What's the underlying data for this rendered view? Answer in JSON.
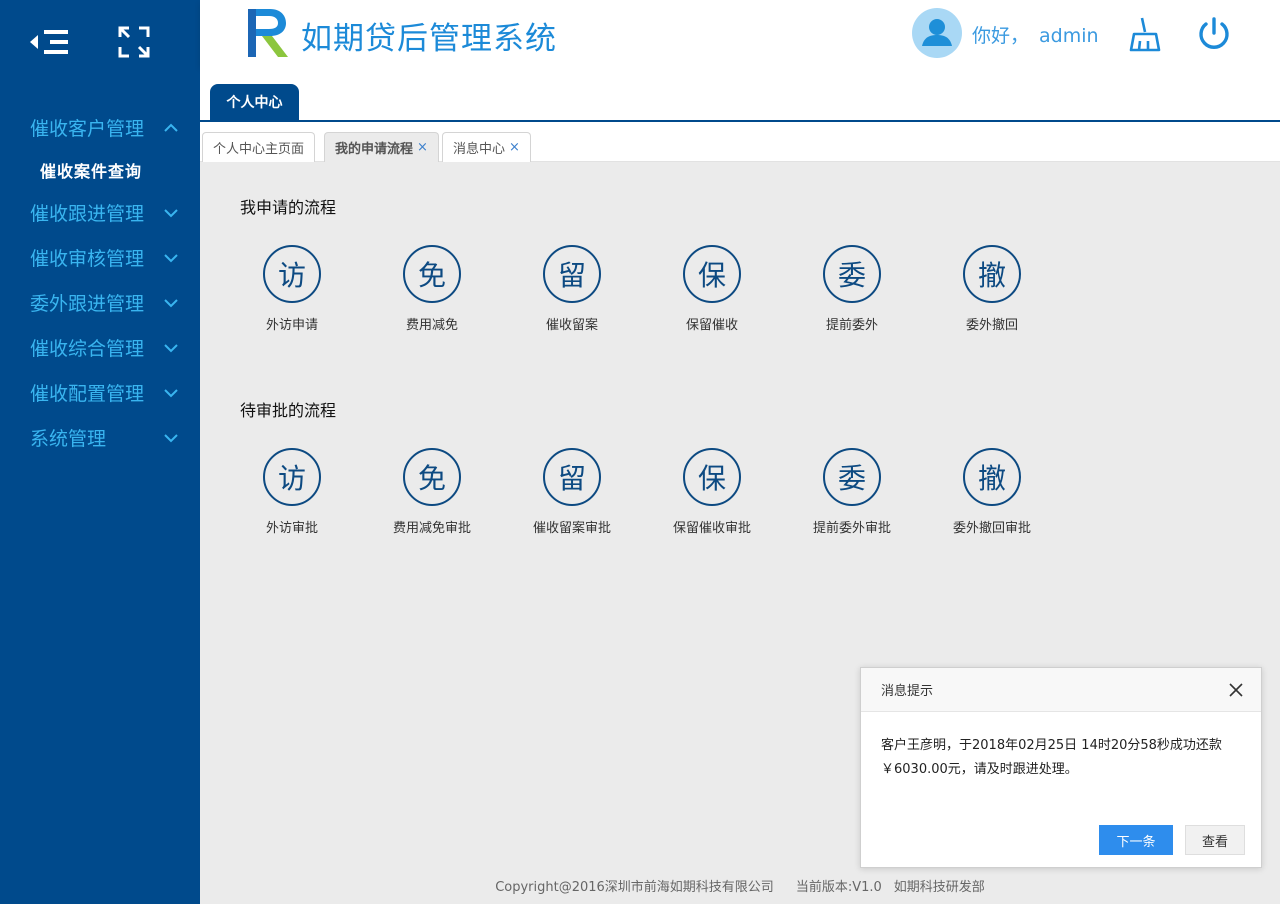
{
  "colors": {
    "sidebar": "#004a8c",
    "accent": "#1c8ad8",
    "menu_text": "#39b5f0",
    "circle": "#0d4a82",
    "primary_button": "#2e8ded"
  },
  "header": {
    "title": "如期贷后管理系统",
    "greeting": "你好，",
    "username": "admin",
    "icons": [
      "menu-collapse-icon",
      "fullscreen-icon",
      "logo-icon",
      "avatar-icon",
      "broom-icon",
      "power-icon"
    ]
  },
  "sidebar": {
    "items": [
      {
        "label": "催收客户管理",
        "expanded": true,
        "children": [
          "催收案件查询"
        ]
      },
      {
        "label": "催收跟进管理"
      },
      {
        "label": "催收审核管理"
      },
      {
        "label": "委外跟进管理"
      },
      {
        "label": "催收综合管理"
      },
      {
        "label": "催收配置管理"
      },
      {
        "label": "系统管理"
      }
    ]
  },
  "tabs_top": [
    "个人中心"
  ],
  "tabs_sub": [
    {
      "label": "个人中心主页面",
      "closable": false
    },
    {
      "label": "我的申请流程",
      "closable": true,
      "active": true
    },
    {
      "label": "消息中心",
      "closable": true
    }
  ],
  "close_symbol": "×",
  "sections": [
    {
      "title": "我申请的流程",
      "items": [
        {
          "char": "访",
          "label": "外访申请"
        },
        {
          "char": "免",
          "label": "费用减免"
        },
        {
          "char": "留",
          "label": "催收留案"
        },
        {
          "char": "保",
          "label": "保留催收"
        },
        {
          "char": "委",
          "label": "提前委外"
        },
        {
          "char": "撤",
          "label": "委外撤回"
        }
      ]
    },
    {
      "title": "待审批的流程",
      "items": [
        {
          "char": "访",
          "label": "外访审批"
        },
        {
          "char": "免",
          "label": "费用减免审批"
        },
        {
          "char": "留",
          "label": "催收留案审批"
        },
        {
          "char": "保",
          "label": "保留催收审批"
        },
        {
          "char": "委",
          "label": "提前委外审批"
        },
        {
          "char": "撤",
          "label": "委外撤回审批"
        }
      ]
    }
  ],
  "popup": {
    "title": "消息提示",
    "line1": "客户王彦明，于2018年02月25日 14时20分58秒成功还款",
    "line2": "￥6030.00元，请及时跟进处理。",
    "next_label": "下一条",
    "view_label": "查看"
  },
  "footer": {
    "copyright": "Copyright@2016深圳市前海如期科技有限公司",
    "version": "当前版本:V1.0",
    "dept": "如期科技研发部"
  }
}
